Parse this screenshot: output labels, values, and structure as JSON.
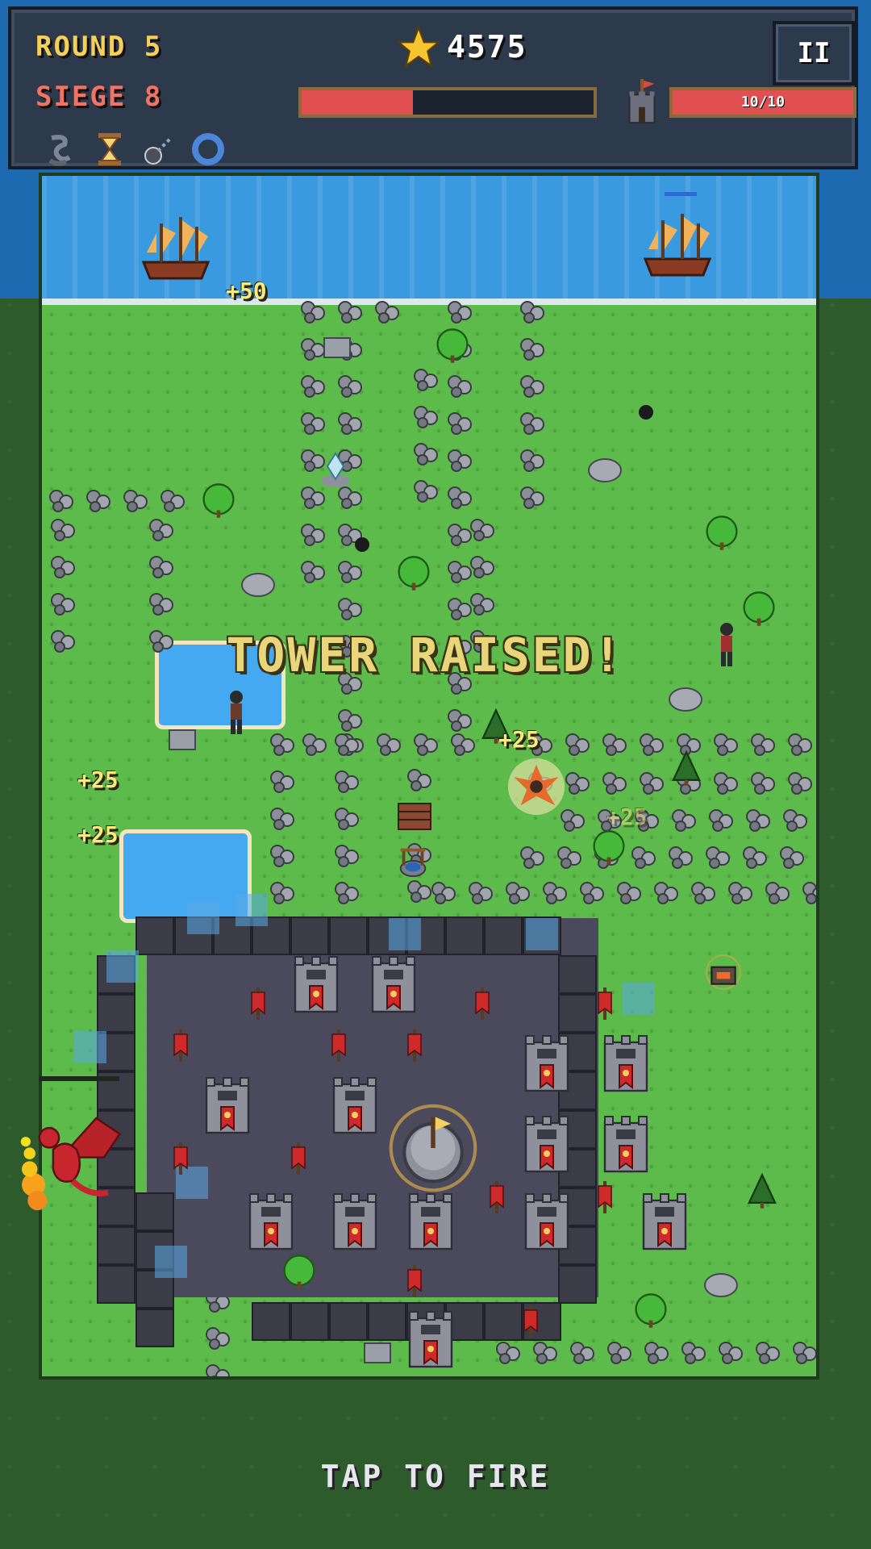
{
  "hud": {
    "round_label": "ROUND 5",
    "siege_label": "SIEGE 8",
    "score": "4575",
    "pause_label": "II",
    "siege_progress": 0.38,
    "health_text": "10/10",
    "health_fraction": 1.0,
    "powerups": [
      "rope-icon",
      "hourglass-icon",
      "flail-icon",
      "ring-icon"
    ]
  },
  "floating": {
    "p50": "+50",
    "p25_a": "+25",
    "p25_b": "+25",
    "p25_c": "+25",
    "p25_d": "+25"
  },
  "announcement": "TOWER RAISED!",
  "hint": "TAP TO FIRE",
  "colors": {
    "accent_gold": "#f4cf5a",
    "siege_red": "#ef7466",
    "bar_red": "#e05050",
    "hud_bg": "#2c3a4c",
    "grass": "#5dbb4b",
    "water": "#3a9ae0"
  }
}
